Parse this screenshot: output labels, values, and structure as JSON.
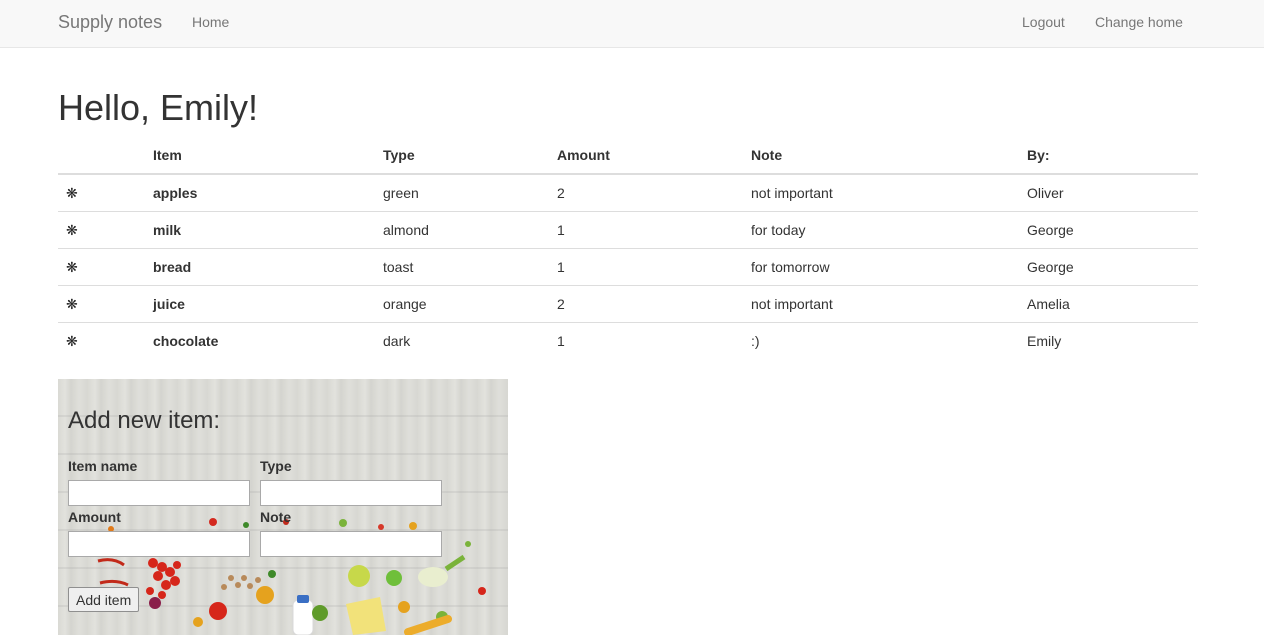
{
  "navbar": {
    "brand": "Supply notes",
    "home": "Home",
    "logout": "Logout",
    "change_home": "Change home"
  },
  "greeting": "Hello, Emily!",
  "table": {
    "headers": [
      "",
      "Item",
      "Type",
      "Amount",
      "Note",
      "By:"
    ],
    "row_icon": "asterisk-icon",
    "row_icon_glyph": "❋",
    "rows": [
      {
        "item": "apples",
        "type": "green",
        "amount": "2",
        "note": "not important",
        "by": "Oliver"
      },
      {
        "item": "milk",
        "type": "almond",
        "amount": "1",
        "note": "for today",
        "by": "George"
      },
      {
        "item": "bread",
        "type": "toast",
        "amount": "1",
        "note": "for tomorrow",
        "by": "George"
      },
      {
        "item": "juice",
        "type": "orange",
        "amount": "2",
        "note": "not important",
        "by": "Amelia"
      },
      {
        "item": "chocolate",
        "type": "dark",
        "amount": "1",
        "note": ":)",
        "by": "Emily"
      }
    ]
  },
  "add_form": {
    "title": "Add new item:",
    "item_name_label": "Item name",
    "type_label": "Type",
    "amount_label": "Amount",
    "note_label": "Note",
    "item_name_value": "",
    "type_value": "",
    "amount_value": "",
    "note_value": "",
    "submit_label": "Add item"
  },
  "colors": {
    "navbar_bg": "#f8f8f8",
    "navbar_text": "#777777",
    "text": "#333333",
    "table_border": "#dddddd"
  }
}
